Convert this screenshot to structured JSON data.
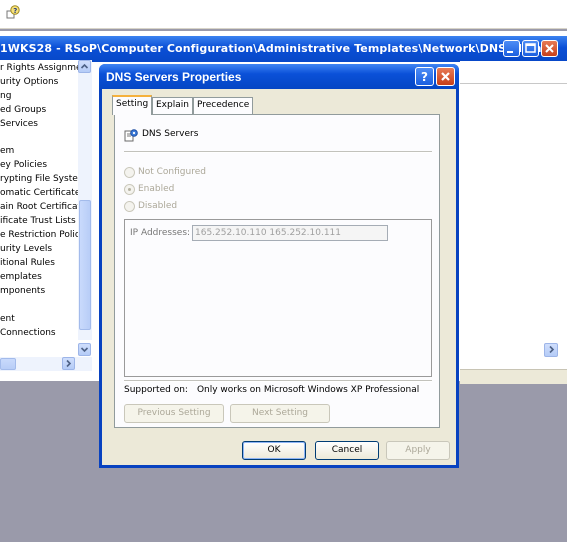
{
  "background_window": {
    "title": "1WKS28 - RSoP\\Computer Configuration\\Administrative Templates\\Network\\DNS Client",
    "tree_items": [
      "r Rights Assignmer",
      "urity Options",
      "ng",
      "ed Groups",
      "Services",
      "",
      "em",
      "ey Policies",
      "rypting File System",
      "omatic Certificate R",
      "ain Root Certificat",
      "ificate Trust Lists",
      "e Restriction Polici",
      "urity Levels",
      "itional Rules",
      "emplates",
      "mponents",
      "",
      "ent",
      "Connections"
    ]
  },
  "dialog": {
    "title": "DNS Servers Properties",
    "help_glyph": "?",
    "close_glyph": "✕",
    "tabs": [
      {
        "label": "Setting",
        "active": true
      },
      {
        "label": "Explain",
        "active": false
      },
      {
        "label": "Precedence",
        "active": false
      }
    ],
    "setting_name": "DNS Servers",
    "options": [
      {
        "label": "Not Configured",
        "selected": false
      },
      {
        "label": "Enabled",
        "selected": true
      },
      {
        "label": "Disabled",
        "selected": false
      }
    ],
    "ip_label": "IP Addresses:",
    "ip_value": "165.252.10.110 165.252.10.111",
    "supported_label": "Supported on:",
    "supported_value": "Only works on Microsoft Windows XP Professional",
    "prev_button": "Previous Setting",
    "next_button": "Next Setting",
    "ok_button": "OK",
    "cancel_button": "Cancel",
    "apply_button": "Apply"
  }
}
